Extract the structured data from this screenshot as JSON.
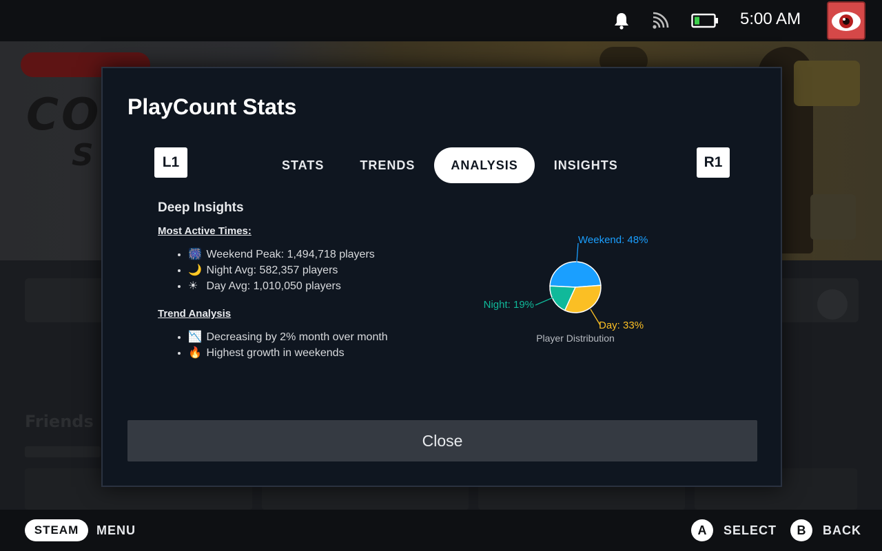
{
  "topbar": {
    "icons": [
      "bell-icon",
      "wifi-icon",
      "battery-icon"
    ],
    "time": "5:00 AM"
  },
  "modal": {
    "title": "PlayCount Stats",
    "left_shoulder": "L1",
    "right_shoulder": "R1",
    "tabs": [
      {
        "label": "STATS",
        "active": false
      },
      {
        "label": "TRENDS",
        "active": false
      },
      {
        "label": "ANALYSIS",
        "active": true
      },
      {
        "label": "INSIGHTS",
        "active": false
      }
    ],
    "deep_insights": {
      "heading": "Deep Insights",
      "most_active": {
        "heading": "Most Active Times:",
        "items": [
          {
            "icon": "🎆",
            "text": "Weekend Peak: 1,494,718 players"
          },
          {
            "icon": "🌙",
            "text": "Night Avg: 582,357 players"
          },
          {
            "icon": "☀",
            "text": "Day Avg: 1,010,050 players"
          }
        ]
      },
      "trend_analysis": {
        "heading": "Trend Analysis",
        "items": [
          {
            "icon": "📉",
            "text": "Decreasing by 2% month over month"
          },
          {
            "icon": "🔥",
            "text": "Highest growth in weekends"
          }
        ]
      }
    },
    "close_label": "Close"
  },
  "chart_data": {
    "type": "pie",
    "title": "Player Distribution",
    "slices": [
      {
        "label": "Weekend: 48%",
        "value": 48,
        "color": "#1a9fff"
      },
      {
        "label": "Day: 33%",
        "value": 33,
        "color": "#fbbf24"
      },
      {
        "label": "Night: 19%",
        "value": 19,
        "color": "#10b99a"
      }
    ]
  },
  "bottombar": {
    "steam_label": "STEAM",
    "menu_label": "MENU",
    "a_button": "A",
    "select_label": "SELECT",
    "b_button": "B",
    "back_label": "BACK"
  }
}
